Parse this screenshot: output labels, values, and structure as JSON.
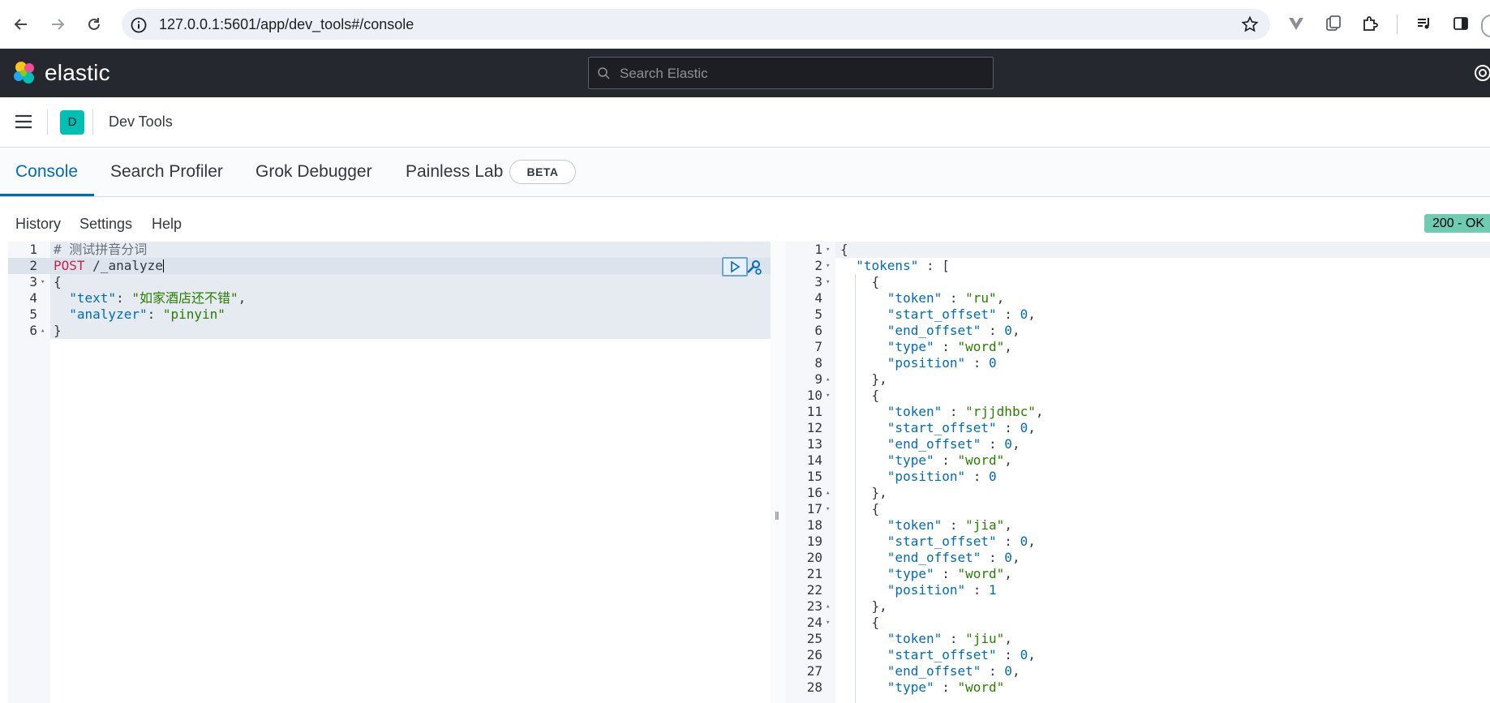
{
  "browser": {
    "url": "127.0.0.1:5601/app/dev_tools#/console"
  },
  "header": {
    "logo_text": "elastic",
    "search_placeholder": "Search Elastic"
  },
  "breadcrumb": {
    "space_initial": "D",
    "title": "Dev Tools"
  },
  "tabs": [
    {
      "label": "Console",
      "active": true
    },
    {
      "label": "Search Profiler",
      "active": false
    },
    {
      "label": "Grok Debugger",
      "active": false
    },
    {
      "label": "Painless Lab",
      "active": false
    }
  ],
  "beta_badge": "BETA",
  "toolbar": {
    "history": "History",
    "settings": "Settings",
    "help": "Help",
    "status": "200 - OK"
  },
  "request": {
    "line_numbers": [
      "1",
      "2",
      "3",
      "4",
      "5",
      "6"
    ],
    "comment": "# 测试拼音分词",
    "method": "POST",
    "path": "/_analyze",
    "open_brace": "{",
    "text_key": "\"text\"",
    "text_value": "\"如家酒店还不错\"",
    "analyzer_key": "\"analyzer\"",
    "analyzer_value": "\"pinyin\"",
    "close_brace": "}"
  },
  "response": {
    "line_numbers": [
      "1",
      "2",
      "3",
      "4",
      "5",
      "6",
      "7",
      "8",
      "9",
      "10",
      "11",
      "12",
      "13",
      "14",
      "15",
      "16",
      "17",
      "18",
      "19",
      "20",
      "21",
      "22",
      "23",
      "24",
      "25",
      "26",
      "27",
      "28"
    ],
    "tokens_key": "\"tokens\"",
    "tokens": [
      {
        "token": "\"ru\"",
        "start_offset": "0",
        "end_offset": "0",
        "type": "\"word\"",
        "position": "0"
      },
      {
        "token": "\"rjjdhbc\"",
        "start_offset": "0",
        "end_offset": "0",
        "type": "\"word\"",
        "position": "0"
      },
      {
        "token": "\"jia\"",
        "start_offset": "0",
        "end_offset": "0",
        "type": "\"word\"",
        "position": "1"
      },
      {
        "token": "\"jiu\"",
        "start_offset": "0",
        "end_offset": "0",
        "type": "\"word\""
      }
    ],
    "labels": {
      "token": "\"token\"",
      "start_offset": "\"start_offset\"",
      "end_offset": "\"end_offset\"",
      "type": "\"type\"",
      "position": "\"position\""
    }
  }
}
